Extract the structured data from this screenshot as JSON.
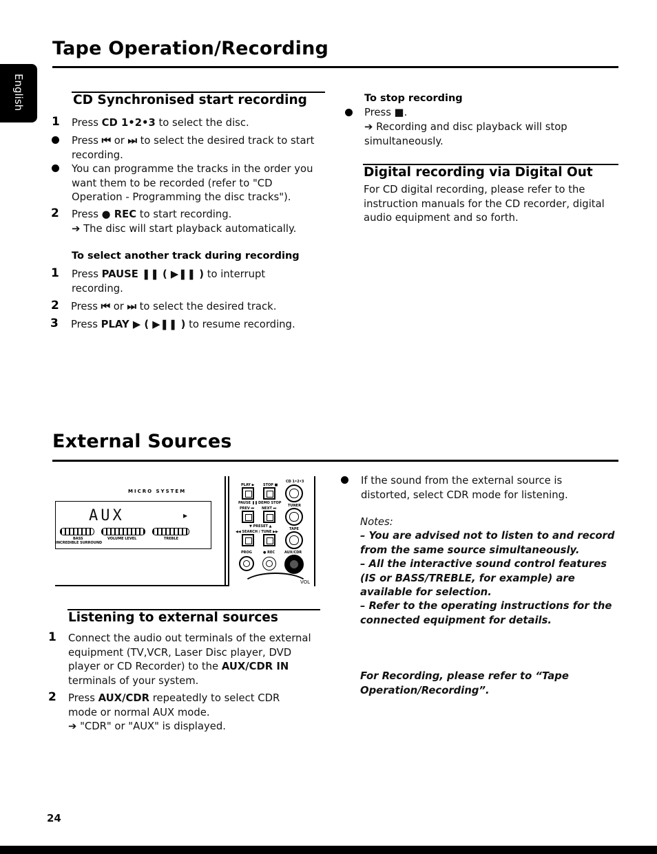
{
  "side_tab": {
    "label": "English"
  },
  "section1": {
    "title": "Tape Operation/Recording",
    "cd_sync": {
      "heading": "CD Synchronised start recording",
      "step1": {
        "num": "1",
        "pre": "Press ",
        "bold": "CD 1•2•3",
        "post": " to select the disc."
      },
      "bullet1": {
        "pre": "Press ",
        "icon1": "⏮",
        "mid": " or ",
        "icon2": "⏭",
        "post": " to select the desired track to start recording."
      },
      "bullet2": {
        "text": "You can programme the tracks in the order you want them to be recorded (refer to \"CD Operation - Programming the disc tracks\")."
      },
      "step2": {
        "num": "2",
        "pre": "Press ",
        "icon": "●",
        "bold": " REC",
        "post": " to start recording.",
        "result": "➔ The disc will start playback automatically."
      }
    },
    "select_another": {
      "heading": "To select another track during recording",
      "step1": {
        "num": "1",
        "pre": "Press ",
        "bold": "PAUSE  ❚❚ ( ▶❚❚ )",
        "post": " to interrupt recording."
      },
      "step2": {
        "num": "2",
        "pre": "Press ",
        "icon1": "⏮",
        "mid": " or ",
        "icon2": "⏭",
        "post": " to select the desired track."
      },
      "step3": {
        "num": "3",
        "pre": "Press ",
        "bold": "PLAY ▶  ( ▶❚❚ )",
        "post": " to resume recording."
      }
    },
    "stop": {
      "heading": "To stop recording",
      "bullet": {
        "pre": "Press ",
        "icon": "■",
        "post": "."
      },
      "result": "➔ Recording and disc playback will stop simultaneously."
    },
    "digital": {
      "heading": "Digital recording via Digital Out",
      "body": "For CD digital recording, please refer to the instruction manuals for the CD recorder, digital audio equipment and so forth."
    }
  },
  "section2": {
    "title": "External Sources",
    "device": {
      "brand": "MICRO SYSTEM",
      "display": "AUX",
      "bar_labels": [
        "BASS",
        "VOLUME LEVEL",
        "TREBLE"
      ],
      "sub_label": "INCREDIBLE SURROUND",
      "buttons": [
        "PLAY ▶",
        "STOP ■",
        "CD 1•2•3",
        "PAUSE ❚❚",
        "DEMO STOP",
        "PREV ⏮",
        "NEXT ⏭",
        "TUNER",
        "▼ PRESET ▲",
        "◀◀ SEARCH / TUNE ▶▶",
        "TAPE",
        "PROG",
        "● REC",
        "AUX/CDR",
        "VOL"
      ]
    },
    "listening": {
      "heading": "Listening to external sources",
      "step1": {
        "num": "1",
        "pre": "Connect the audio out terminals of the external equipment (TV,VCR, Laser Disc player, DVD player or CD Recorder) to the ",
        "bold": "AUX/CDR IN",
        "post": " terminals of your system."
      },
      "step2": {
        "num": "2",
        "pre": "Press ",
        "bold": "AUX/CDR",
        "post": " repeatedly to select CDR mode or normal AUX mode.",
        "result": "➔ \"CDR\" or \"AUX\" is displayed."
      }
    },
    "distorted_bullet": "If the sound from the external source is distorted, select CDR mode for listening.",
    "notes": {
      "label": "Notes:",
      "items": [
        "–  You are advised not to listen to and record from the same source simultaneously.",
        "–  All the interactive sound control features (IS or BASS/TREBLE, for example) are available for selection.",
        "–  Refer to the operating instructions for the connected equipment for details."
      ]
    },
    "recording_ref": "For Recording, please refer to “Tape Operation/Recording”."
  },
  "footer": {
    "page_number": "24"
  }
}
